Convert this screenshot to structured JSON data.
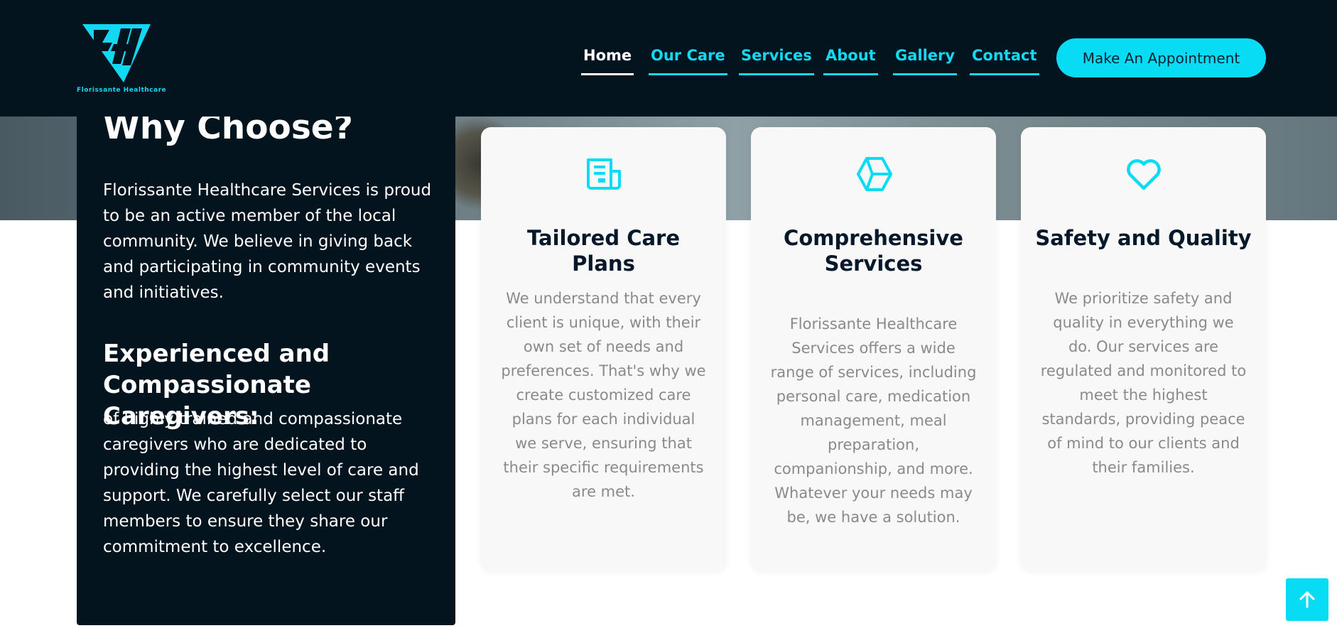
{
  "brand": {
    "logo_text": "Florissante Healthcare",
    "accent_color": "#08dcf5",
    "dark_color": "#03141f"
  },
  "nav": {
    "items": [
      {
        "label": "Home",
        "active": true
      },
      {
        "label": "Our Care",
        "active": false
      },
      {
        "label": "Services",
        "active": false
      },
      {
        "label": "About",
        "active": false
      },
      {
        "label": "Gallery",
        "active": false
      },
      {
        "label": "Contact",
        "active": false
      }
    ],
    "cta_label": "Make An Appointment"
  },
  "why": {
    "title": "Why Choose?",
    "intro": "Florissante Healthcare Services is proud to be an active member of the local community. We believe in giving back and participating in community events and initiatives.",
    "subtitle": "Experienced and Compassionate Caregivers:",
    "body": "of highly trained and compassionate caregivers who are dedicated to providing the highest level of care and support. We carefully select our staff members to ensure they share our commitment to excellence."
  },
  "cards": [
    {
      "icon": "document-icon",
      "title": "Tailored Care Plans",
      "text": "We understand that every client is unique, with their own set of needs and preferences. That's why we create customized care plans for each individual we serve, ensuring that their specific requirements are met."
    },
    {
      "icon": "cube-icon",
      "title": "Comprehensive Services",
      "text": "Florissante Healthcare Services offers a wide range of services, including personal care, medication management, meal preparation, companionship, and more. Whatever your needs may be, we have a solution."
    },
    {
      "icon": "heart-icon",
      "title": "Safety and Quality",
      "text": "We prioritize safety and quality in everything we do. Our services are regulated and monitored to meet the highest standards, providing peace of mind to our clients and their families."
    }
  ],
  "back_to_top_icon": "arrow-up-icon"
}
